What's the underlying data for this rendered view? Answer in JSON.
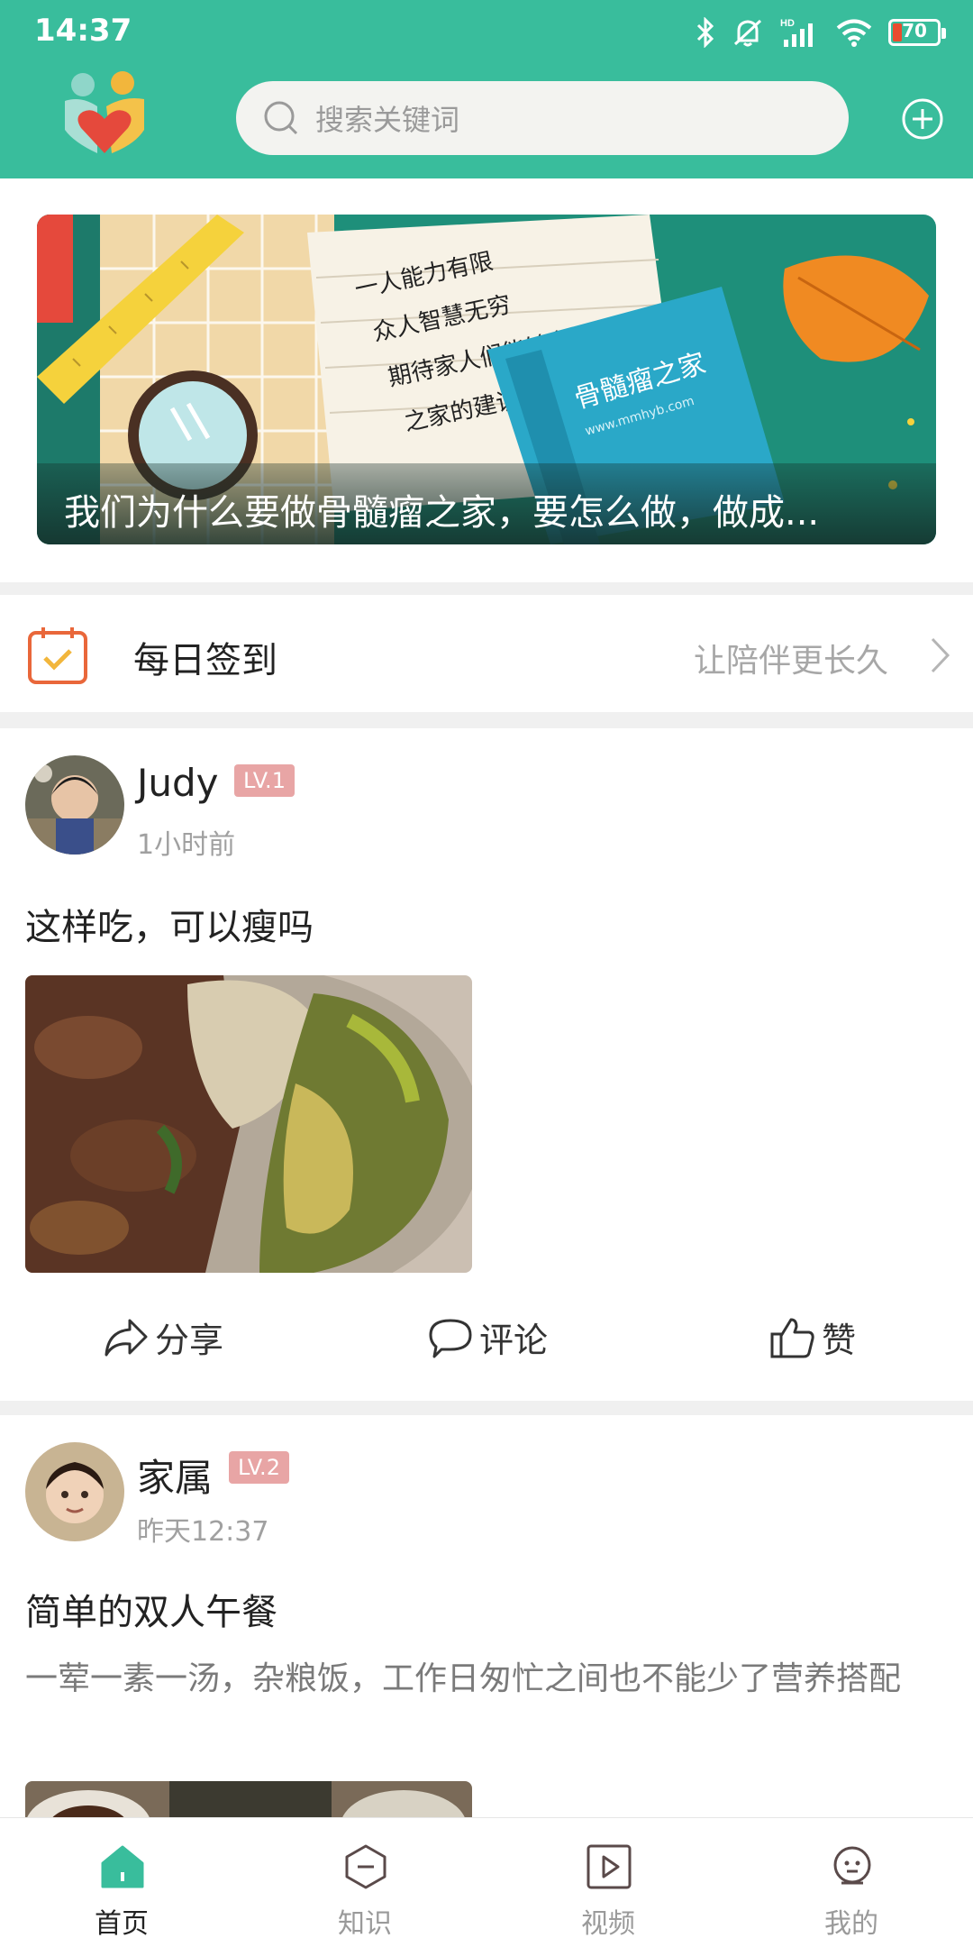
{
  "status_bar": {
    "time": "14:37",
    "battery": "70",
    "icons": [
      "bluetooth-icon",
      "mute-icon",
      "hd-signal-icon",
      "wifi-icon",
      "battery-icon"
    ]
  },
  "header": {
    "search_placeholder": "搜索关键词",
    "logo": "app-logo",
    "add_icon": "plus-circle-icon"
  },
  "banner": {
    "caption": "我们为什么要做骨髓瘤之家，要怎么做，做成...",
    "image_text": [
      "一人能力有限",
      "众人智慧无穷",
      "期待家人们能够参与到骨髓瘤",
      "之家的建设中来"
    ],
    "image_brand": "骨髓瘤之家",
    "image_url_text": "www.mmhyb.com"
  },
  "checkin": {
    "title": "每日签到",
    "slogan": "让陪伴更长久",
    "icon": "calendar-check-icon"
  },
  "posts": [
    {
      "user": "Judy",
      "level": "LV.1",
      "time": "1小时前",
      "title": "这样吃，可以瘦吗",
      "actions": {
        "share": "分享",
        "comment": "评论",
        "like": "赞"
      }
    },
    {
      "user": "家属",
      "level": "LV.2",
      "time": "昨天12:37",
      "title": "简单的双人午餐",
      "desc": "一荤一素一汤，杂粮饭，工作日匆忙之间也不能少了营养搭配"
    }
  ],
  "bottom_nav": [
    {
      "label": "首页",
      "icon": "home-icon",
      "active": true
    },
    {
      "label": "知识",
      "icon": "knowledge-icon",
      "active": false
    },
    {
      "label": "视频",
      "icon": "video-icon",
      "active": false
    },
    {
      "label": "我的",
      "icon": "profile-icon",
      "active": false
    }
  ],
  "colors": {
    "brand": "#39bd9c",
    "level_badge": "#e8a5a5",
    "checkin_icon": "#e9673a",
    "muted_text": "#a0a0a0"
  }
}
